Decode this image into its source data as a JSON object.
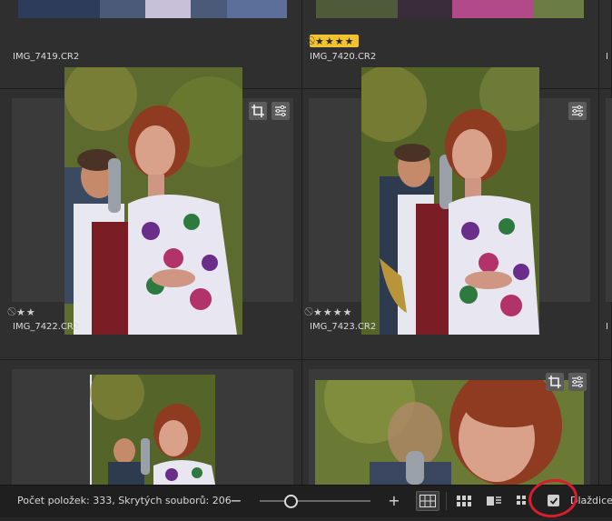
{
  "grid": {
    "items": [
      {
        "filename": "IMG_7419.CR2",
        "rating": 0
      },
      {
        "filename": "IMG_7420.CR2",
        "rating": 4,
        "rejected_marker": true,
        "highlight": "#f2c230"
      },
      {
        "filename": "IMG_7422.CR2",
        "rating": 2,
        "rejected_marker": true
      },
      {
        "filename": "IMG_7423.CR2",
        "rating": 4,
        "rejected_marker": true
      },
      {
        "filename": "I",
        "rating": 0
      },
      {
        "filename": "I",
        "rating": 0
      }
    ],
    "overlay_icons": [
      "crop-icon",
      "adjustments-icon"
    ]
  },
  "statusbar": {
    "count_text": "Počet položek: 333, Skrytých souborů: 206",
    "zoom_out": "−",
    "zoom_in": "+",
    "zoom_level": 0.28,
    "tiles_label": "Dlaždice",
    "tiles_checked": true
  },
  "colors": {
    "accent": "#f2c230",
    "annotation": "#d81e2c"
  },
  "icons": [
    "grid-view-icon",
    "compact-grid-icon",
    "detail-view-icon",
    "list-view-icon",
    "checkbox-icon"
  ]
}
